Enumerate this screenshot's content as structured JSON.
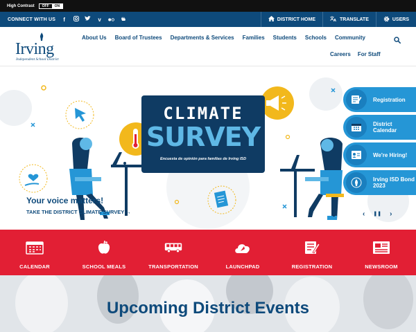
{
  "topbar": {
    "high_contrast_label": "High Contrast",
    "toggle_off": "OFF",
    "toggle_on": "ON"
  },
  "utility": {
    "connect_label": "CONNECT WITH US",
    "social_icons": [
      "facebook-icon",
      "instagram-icon",
      "twitter-icon",
      "vimeo-icon",
      "flickr-icon",
      "peachjar-icon"
    ],
    "links": [
      {
        "label": "DISTRICT HOME",
        "icon": "home-icon"
      },
      {
        "label": "TRANSLATE",
        "icon": "translate-icon"
      },
      {
        "label": "USERS",
        "icon": "gear-icon"
      }
    ]
  },
  "logo": {
    "word": "Irving",
    "subtitle": "Independent School District"
  },
  "nav": {
    "row1": [
      "About Us",
      "Board of Trustees",
      "Departments & Services",
      "Families",
      "Students",
      "Schools",
      "Community"
    ],
    "row2": [
      "Careers",
      "For Staff"
    ]
  },
  "hero": {
    "board_line1": "CLIMATE",
    "board_line2": "SURVEY",
    "board_line3": "Encuesta de opinión para familias de Irving ISD",
    "title": "Your voice matters!",
    "link": "TAKE THE DISTRICT CLIMATE SURVEY →",
    "controls": {
      "prev": "‹",
      "pause": "❚❚",
      "next": "›"
    }
  },
  "quick_links": [
    {
      "label": "Registration",
      "icon": "registration-icon"
    },
    {
      "label": "District Calendar",
      "icon": "calendar-icon"
    },
    {
      "label": "We're Hiring!",
      "icon": "hiring-icon"
    },
    {
      "label": "Irving ISD Bond 2023",
      "icon": "bond-icon"
    }
  ],
  "red_bar": [
    {
      "label": "CALENDAR",
      "icon": "calendar-icon"
    },
    {
      "label": "SCHOOL MEALS",
      "icon": "apple-icon"
    },
    {
      "label": "TRANSPORTATION",
      "icon": "bus-icon"
    },
    {
      "label": "LAUNCHPAD",
      "icon": "launchpad-icon"
    },
    {
      "label": "REGISTRATION",
      "icon": "registration-icon"
    },
    {
      "label": "NEWSROOM",
      "icon": "newspaper-icon"
    }
  ],
  "events": {
    "title": "Upcoming District Events"
  },
  "colors": {
    "navy": "#0e4a7b",
    "red": "#e21f34",
    "light_blue": "#2596d6",
    "sky": "#5fb8e6",
    "yellow": "#f2b81c"
  }
}
